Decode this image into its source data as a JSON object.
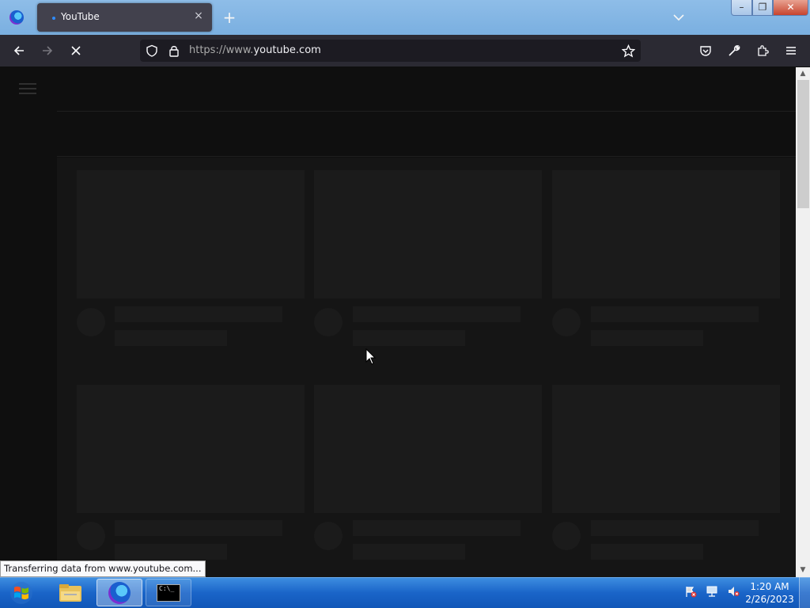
{
  "browser": {
    "tab": {
      "title": "YouTube",
      "close_glyph": "×"
    },
    "new_tab_glyph": "+",
    "url": {
      "scheme": "https://www.",
      "host": "youtube.com"
    },
    "status_text": "Transferring data from www.youtube.com...",
    "window_buttons": {
      "minimize": "–",
      "maximize": "❐",
      "close": "✕"
    }
  },
  "icons": [
    "firefox-logo-icon",
    "back-arrow-icon",
    "forward-arrow-icon",
    "stop-loading-icon",
    "shield-icon",
    "lock-icon",
    "bookmark-star-icon",
    "pocket-icon",
    "wrench-icon",
    "extensions-icon",
    "hamburger-menu-icon",
    "list-all-tabs-icon",
    "hamburger-icon",
    "scroll-up-icon",
    "scroll-down-icon",
    "windows-start-icon",
    "file-explorer-icon",
    "firefox-taskbar-icon",
    "cmd-icon",
    "action-center-flag-icon",
    "network-icon",
    "volume-muted-icon",
    "mouse-cursor-icon"
  ],
  "taskbar": {
    "cmd_label": "C:\\_",
    "clock": {
      "time": "1:20 AM",
      "date": "2/26/2023"
    }
  },
  "page": {
    "state": "loading-skeleton",
    "skeleton_cards_visible": 6
  },
  "colors": {
    "page_bg": "#0f0f0f",
    "skeleton": "#1b1b1b",
    "toolbar": "#2b2a33",
    "tab": "#42414d",
    "taskbar": "#1a64c8"
  }
}
